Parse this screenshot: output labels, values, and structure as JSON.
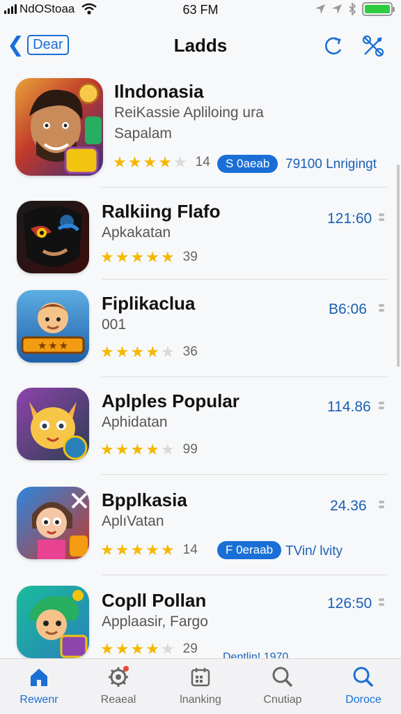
{
  "status_bar": {
    "carrier": "NdOStoaa",
    "time": "63 FM"
  },
  "nav": {
    "back_label": "Dear",
    "title": "Ladds"
  },
  "apps": [
    {
      "name": "Ilndonasia",
      "subtitle_1": "ReiKassie Apliloing ura",
      "subtitle_2": "Sapalam",
      "stars": 4,
      "rating_count": "14",
      "pill": "S 0aeab",
      "extra": "79100 Lnrigingt",
      "icon": "hero-game-icon"
    },
    {
      "name": "Ralkiing Flafo",
      "subtitle_1": "Apkakatan",
      "stars": 5,
      "rating_count": "39",
      "size": "121:60",
      "icon": "dark-mask-icon"
    },
    {
      "name": "Fiplikaclua",
      "subtitle_1": "001",
      "stars": 3.5,
      "rating_count": "36",
      "size": "B6:06",
      "icon": "kid-adventure-icon"
    },
    {
      "name": "Aplples Popular",
      "subtitle_1": "Aphidatan",
      "stars": 3.5,
      "rating_count": "99",
      "size": "114.86",
      "icon": "fox-character-icon"
    },
    {
      "name": "Bpplkasia",
      "subtitle_1": "AplıVatan",
      "stars": 4.5,
      "rating_count": "14",
      "size": "24.36",
      "pill": "F 0eraab",
      "extra": "TVin/ lvity",
      "icon": "cartoon-girl-icon"
    },
    {
      "name": "Copll Pollan",
      "subtitle_1": "Applaasir, Fargo",
      "stars": 4,
      "rating_count": "29",
      "size": "126:50",
      "extra": "Dentlin! 1970",
      "icon": "green-hair-boy-icon"
    }
  ],
  "tabs": [
    {
      "label": "Rewenr",
      "icon": "home-icon",
      "active": true
    },
    {
      "label": "Reaeal",
      "icon": "gear-icon",
      "active": false
    },
    {
      "label": "lnanking",
      "icon": "calendar-icon",
      "active": false
    },
    {
      "label": "Cnutiap",
      "icon": "search-icon",
      "active": false
    },
    {
      "label": "Doroce",
      "icon": "search-icon",
      "active": true
    }
  ],
  "colors": {
    "accent": "#1a6fd6",
    "star": "#f5b800",
    "battery": "#2ecc40"
  }
}
